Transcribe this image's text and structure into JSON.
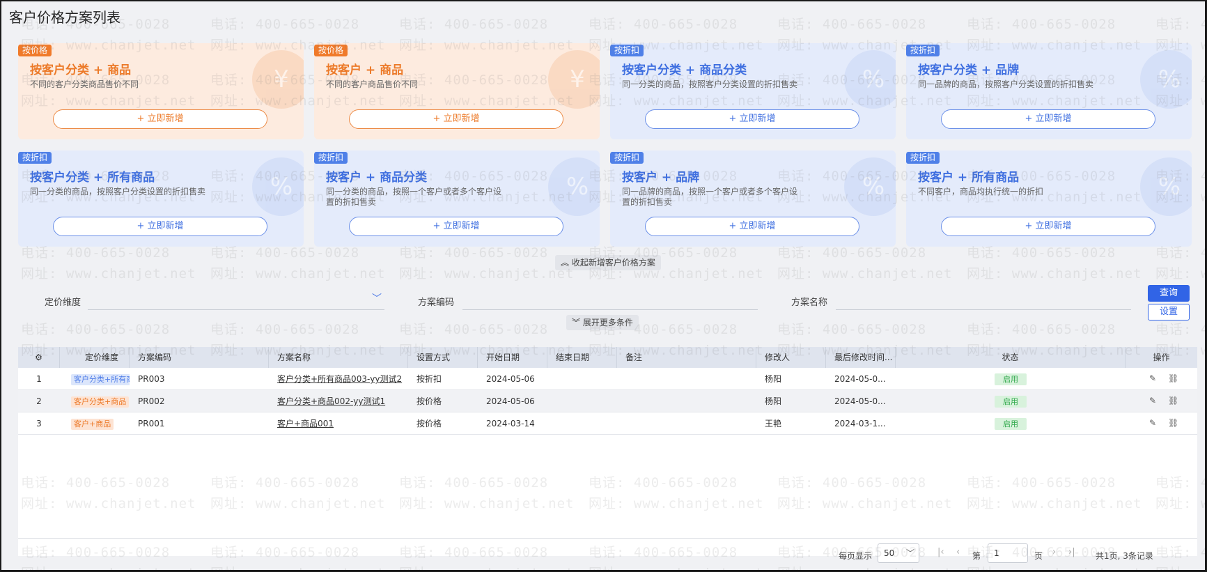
{
  "page_title": "客户价格方案列表",
  "watermark": {
    "phone": "电话: 400-665-0028",
    "site": "网址: www.chanjet.net"
  },
  "cards": [
    {
      "tag": "按价格",
      "title": "按客户分类 + 商品",
      "desc": "不同的客户分类商品售价不同",
      "button": "+ 立即新增",
      "kind": "price",
      "deco": "¥"
    },
    {
      "tag": "按价格",
      "title": "按客户 + 商品",
      "desc": "不同的客户商品售价不同",
      "button": "+ 立即新增",
      "kind": "price",
      "deco": "¥"
    },
    {
      "tag": "按折扣",
      "title": "按客户分类 + 商品分类",
      "desc": "同一分类的商品，按照客户分类设置的折扣售卖",
      "button": "+ 立即新增",
      "kind": "disc",
      "deco": "%"
    },
    {
      "tag": "按折扣",
      "title": "按客户分类 + 品牌",
      "desc": "同一品牌的商品，按照客户分类设置的折扣售卖",
      "button": "+ 立即新增",
      "kind": "disc",
      "deco": "%"
    },
    {
      "tag": "按折扣",
      "title": "按客户分类 + 所有商品",
      "desc": "同一分类的商品，按照客户分类设置的折扣售卖",
      "button": "+ 立即新增",
      "kind": "disc",
      "deco": "%"
    },
    {
      "tag": "按折扣",
      "title": "按客户 + 商品分类",
      "desc": "同一分类的商品，按照一个客户或者多个客户设置的折扣售卖",
      "button": "+ 立即新增",
      "kind": "disc",
      "deco": "%"
    },
    {
      "tag": "按折扣",
      "title": "按客户 + 品牌",
      "desc": "同一品牌的商品，按照一个客户或者多个客户设置的折扣售卖",
      "button": "+ 立即新增",
      "kind": "disc",
      "deco": "%"
    },
    {
      "tag": "按折扣",
      "title": "按客户 + 所有商品",
      "desc": "不同客户，商品均执行统一的折扣",
      "button": "+ 立即新增",
      "kind": "disc",
      "deco": "%"
    }
  ],
  "collapse_label": "收起新增客户价格方案",
  "filters": {
    "pricing_dimension_label": "定价维度",
    "scheme_code_label": "方案编码",
    "scheme_name_label": "方案名称",
    "query_button": "查询",
    "setting_button": "设置",
    "expand_label": "展开更多条件"
  },
  "table": {
    "columns": [
      "定价维度",
      "方案编码",
      "方案名称",
      "设置方式",
      "开始日期",
      "结束日期",
      "备注",
      "修改人",
      "最后修改时间...",
      "状态",
      "操作"
    ],
    "rows": [
      {
        "index": "1",
        "dimension": "客户分类+所有商品",
        "dimension_kind": "disc",
        "code": "PR003",
        "name": "客户分类+所有商品003-yy测试2",
        "method": "按折扣",
        "start": "2024-05-06",
        "end": "",
        "remark": "",
        "modifier": "杨阳",
        "modified": "2024-05-0...",
        "status": "启用"
      },
      {
        "index": "2",
        "dimension": "客户分类+商品",
        "dimension_kind": "price",
        "code": "PR002",
        "name": "客户分类+商品002-yy测试1",
        "method": "按价格",
        "start": "2024-05-06",
        "end": "",
        "remark": "",
        "modifier": "杨阳",
        "modified": "2024-05-0...",
        "status": "启用"
      },
      {
        "index": "3",
        "dimension": "客户+商品",
        "dimension_kind": "price",
        "code": "PR001",
        "name": "客户+商品001",
        "method": "按价格",
        "start": "2024-03-14",
        "end": "",
        "remark": "",
        "modifier": "王艳",
        "modified": "2024-03-1...",
        "status": "启用"
      }
    ]
  },
  "pager": {
    "per_page_label": "每页显示",
    "per_page_value": "50",
    "page_prefix": "第",
    "page_value": "1",
    "page_suffix": "页",
    "summary": "共1页, 3条记录"
  },
  "icons": {
    "settings": "gear-icon",
    "edit": "edit-icon",
    "more": "link-icon",
    "caret": "chevron-down-icon"
  }
}
